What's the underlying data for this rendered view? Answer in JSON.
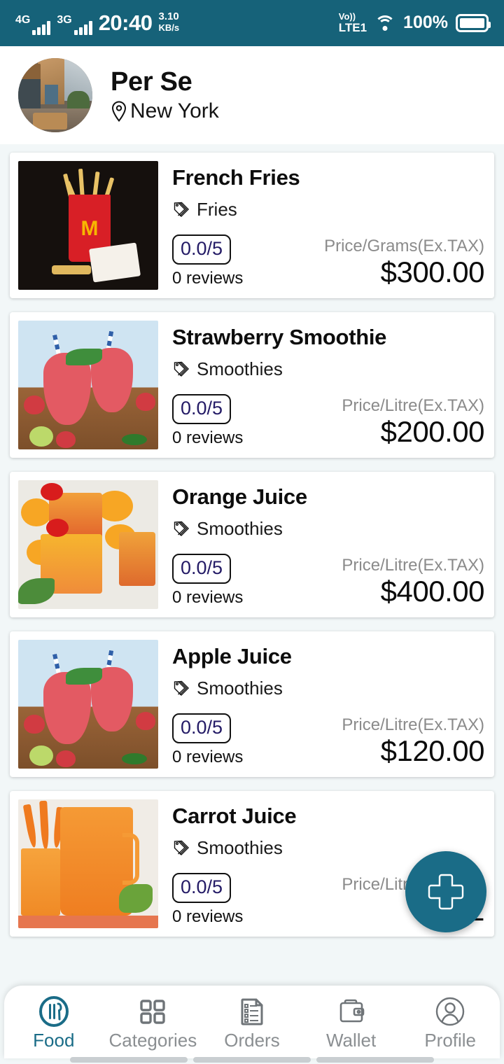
{
  "status_bar": {
    "network_4g": "4G",
    "network_3g": "3G",
    "time": "20:40",
    "speed_value": "3.10",
    "speed_unit": "KB/s",
    "volte_top": "Vo))",
    "volte_bottom": "LTE1",
    "wifi_icon": "wifi-icon",
    "battery_percent": "100%",
    "battery_icon": "battery-full-icon",
    "background": "#166279"
  },
  "header": {
    "avatar_name": "restaurant-photo",
    "restaurant": "Per Se",
    "location": "New York",
    "location_icon": "map-pin-icon"
  },
  "items": [
    {
      "name": "French Fries",
      "category": "Fries",
      "category_icon": "tags-icon",
      "rating": "0.0/5",
      "reviews": "0 reviews",
      "price_label": "Price/Grams(Ex.TAX)",
      "price": "$300.00",
      "thumb": "french-fries-photo"
    },
    {
      "name": "Strawberry Smoothie",
      "category": "Smoothies",
      "category_icon": "tags-icon",
      "rating": "0.0/5",
      "reviews": "0 reviews",
      "price_label": "Price/Litre(Ex.TAX)",
      "price": "$200.00",
      "thumb": "strawberry-smoothie-photo"
    },
    {
      "name": "Orange Juice",
      "category": "Smoothies",
      "category_icon": "tags-icon",
      "rating": "0.0/5",
      "reviews": "0 reviews",
      "price_label": "Price/Litre(Ex.TAX)",
      "price": "$400.00",
      "thumb": "orange-juice-photo"
    },
    {
      "name": "Apple Juice",
      "category": "Smoothies",
      "category_icon": "tags-icon",
      "rating": "0.0/5",
      "reviews": "0 reviews",
      "price_label": "Price/Litre(Ex.TAX)",
      "price": "$120.00",
      "thumb": "apple-juice-photo"
    },
    {
      "name": "Carrot Juice",
      "category": "Smoothies",
      "category_icon": "tags-icon",
      "rating": "0.0/5",
      "reviews": "0 reviews",
      "price_label": "Price/Litre(Ex.TAX)",
      "price": "$2",
      "thumb": "carrot-juice-photo"
    }
  ],
  "fab": {
    "icon": "plus-icon",
    "color": "#1a6c87"
  },
  "bottom_nav": {
    "active_color": "#1a6c87",
    "inactive_color": "#8b8f92",
    "items": [
      {
        "label": "Food",
        "icon": "food-plate-icon"
      },
      {
        "label": "Categories",
        "icon": "grid-squares-icon"
      },
      {
        "label": "Orders",
        "icon": "checklist-document-icon"
      },
      {
        "label": "Wallet",
        "icon": "wallet-icon"
      },
      {
        "label": "Profile",
        "icon": "person-circle-icon"
      }
    ]
  }
}
